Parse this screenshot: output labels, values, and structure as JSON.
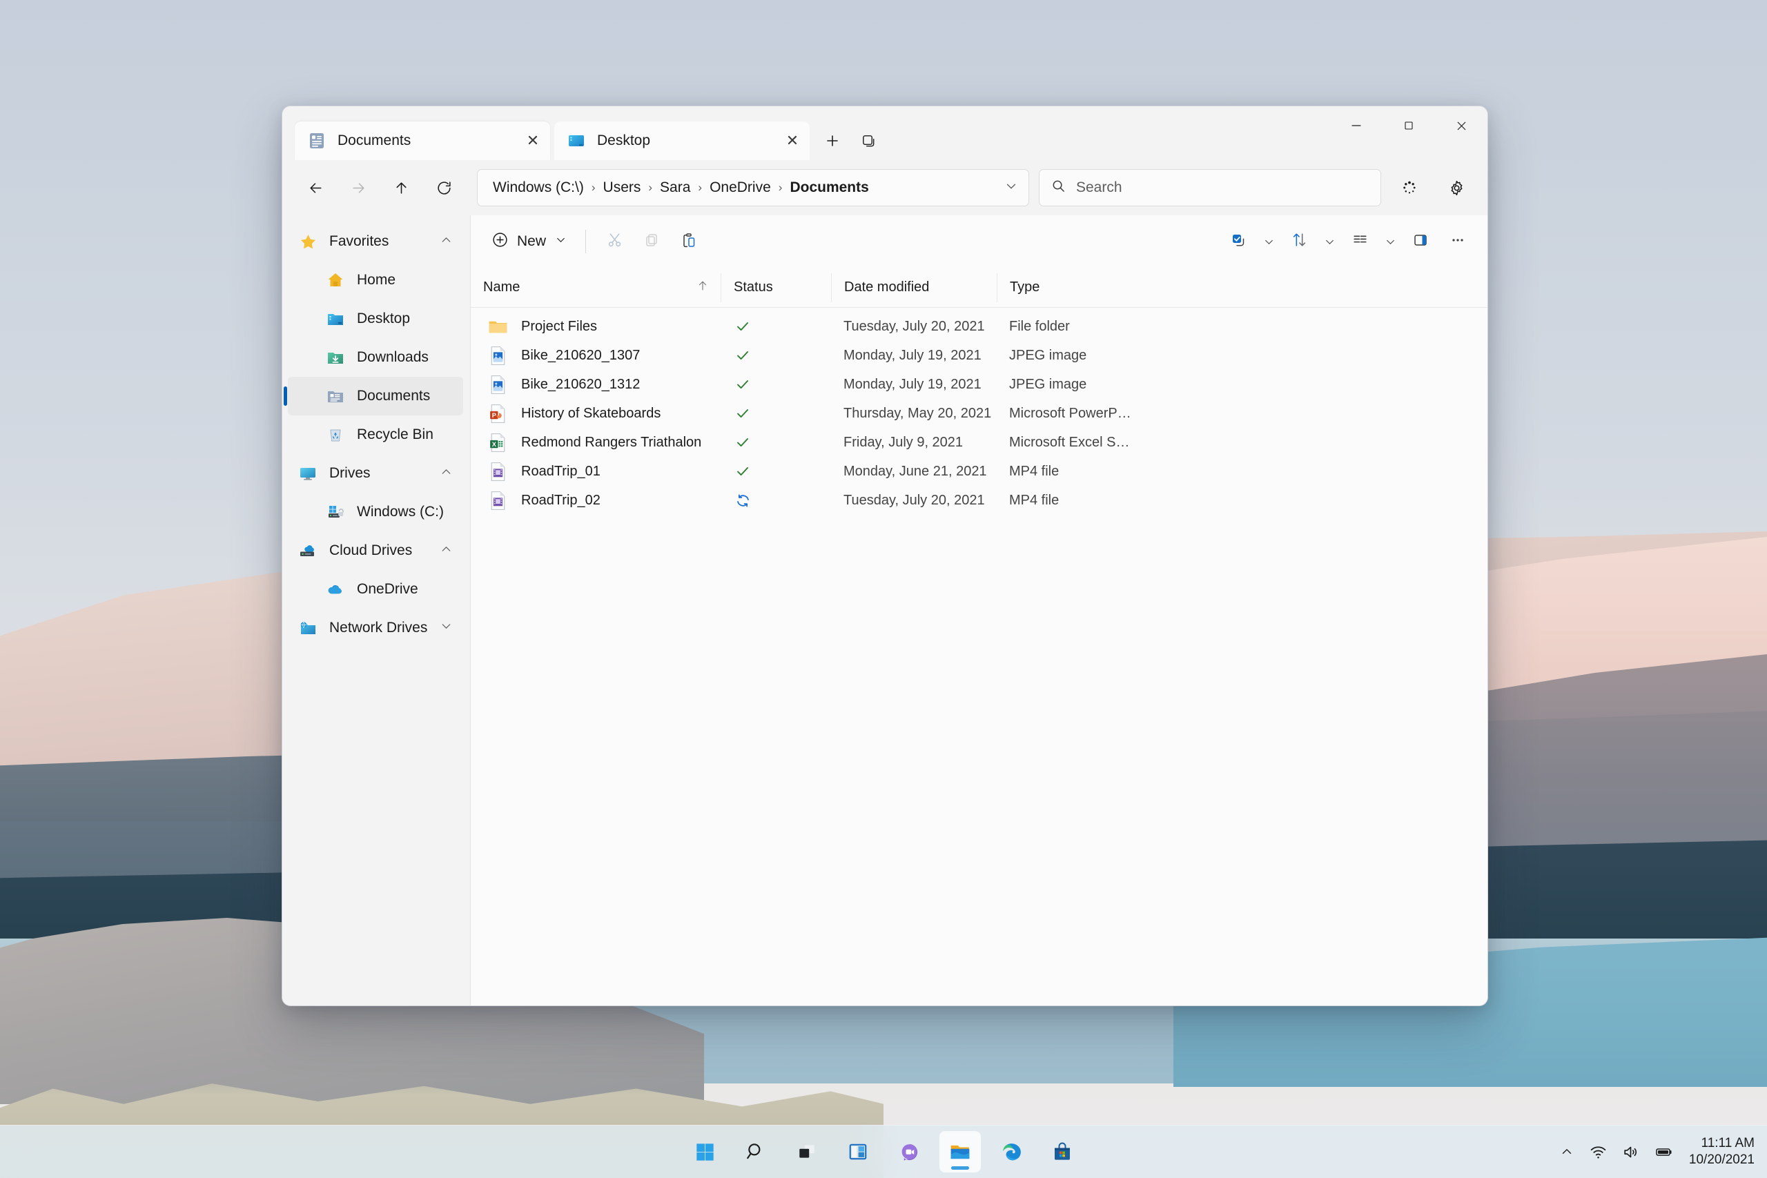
{
  "window": {
    "tabs": [
      {
        "label": "Documents",
        "icon": "documents-folder-icon",
        "active": true,
        "close": "✕"
      },
      {
        "label": "Desktop",
        "icon": "desktop-folder-icon",
        "active": false,
        "close": "✕"
      }
    ],
    "new_tab_tooltip": "Add new tab",
    "tab_list_tooltip": "Tab list",
    "controls": {
      "minimize": "−",
      "maximize": "☐",
      "close": "✕"
    }
  },
  "navbar": {
    "back": "back-arrow",
    "forward": "forward-arrow",
    "up": "up-arrow",
    "refresh": "refresh-arrow",
    "breadcrumb": [
      "Windows (C:\\)",
      "Users",
      "Sara",
      "OneDrive",
      "Documents"
    ],
    "breadcrumb_separator": "›",
    "breadcrumb_chevron": "⌄",
    "search": {
      "placeholder": "Search",
      "value": ""
    },
    "progress_icon": "progress-dots-icon",
    "settings_icon": "gear-icon"
  },
  "sidebar": {
    "groups": [
      {
        "label": "Favorites",
        "icon": "star-icon",
        "expanded": true,
        "chevron": "up",
        "items": [
          {
            "label": "Home",
            "icon": "home-icon",
            "selected": false
          },
          {
            "label": "Desktop",
            "icon": "desktop-folder-icon",
            "selected": false
          },
          {
            "label": "Downloads",
            "icon": "downloads-folder-icon",
            "selected": false
          },
          {
            "label": "Documents",
            "icon": "documents-folder-icon",
            "selected": true
          },
          {
            "label": "Recycle Bin",
            "icon": "recycle-bin-icon",
            "selected": false
          }
        ]
      },
      {
        "label": "Drives",
        "icon": "monitor-icon",
        "expanded": true,
        "chevron": "up",
        "items": [
          {
            "label": "Windows (C:)",
            "icon": "windows-drive-icon",
            "selected": false
          }
        ]
      },
      {
        "label": "Cloud Drives",
        "icon": "cloud-drive-icon",
        "expanded": true,
        "chevron": "up",
        "items": [
          {
            "label": "OneDrive",
            "icon": "onedrive-icon",
            "selected": false
          }
        ]
      },
      {
        "label": "Network Drives",
        "icon": "network-drive-icon",
        "expanded": false,
        "chevron": "down",
        "items": []
      }
    ]
  },
  "toolbar": {
    "new_label": "New",
    "new_icon": "plus-circle-icon",
    "new_chevron": "⌄",
    "cut_icon": "scissors-icon",
    "copy_icon": "copy-icon",
    "paste_icon": "paste-icon",
    "select_icon": "select-checkbox-icon",
    "select_chevron": "⌄",
    "sort_icon": "sort-arrows-icon",
    "sort_chevron": "⌄",
    "view_icon": "view-list-icon",
    "view_chevron": "⌄",
    "details_pane_icon": "details-pane-icon",
    "more_icon": "more-ellipsis-icon"
  },
  "filelist": {
    "columns": [
      {
        "label": "Name",
        "sort": "ascending"
      },
      {
        "label": "Status",
        "sort": null
      },
      {
        "label": "Date modified",
        "sort": null
      },
      {
        "label": "Type",
        "sort": null
      }
    ],
    "rows": [
      {
        "name": "Project Files",
        "icon": "folder-icon",
        "status": "synced",
        "date": "Tuesday, July 20, 2021",
        "type": "File folder"
      },
      {
        "name": "Bike_210620_1307",
        "icon": "jpeg-file-icon",
        "status": "synced",
        "date": "Monday, July 19, 2021",
        "type": "JPEG image"
      },
      {
        "name": "Bike_210620_1312",
        "icon": "jpeg-file-icon",
        "status": "synced",
        "date": "Monday, July 19, 2021",
        "type": "JPEG image"
      },
      {
        "name": "History of Skateboards",
        "icon": "powerpoint-icon",
        "status": "synced",
        "date": "Thursday, May 20, 2021",
        "type": "Microsoft PowerPoi..."
      },
      {
        "name": "Redmond Rangers Triathalon",
        "icon": "excel-icon",
        "status": "synced",
        "date": "Friday, July 9, 2021",
        "type": "Microsoft Excel Spr..."
      },
      {
        "name": "RoadTrip_01",
        "icon": "video-file-icon",
        "status": "synced",
        "date": "Monday, June 21, 2021",
        "type": "MP4 file"
      },
      {
        "name": "RoadTrip_02",
        "icon": "video-file-icon",
        "status": "syncing",
        "date": "Tuesday, July 20, 2021",
        "type": "MP4 file"
      }
    ]
  },
  "taskbar": {
    "items": [
      {
        "name": "start-button",
        "label": "Start"
      },
      {
        "name": "search-button",
        "label": "Search"
      },
      {
        "name": "task-view-button",
        "label": "Task view"
      },
      {
        "name": "widgets-button",
        "label": "Widgets"
      },
      {
        "name": "chat-button",
        "label": "Chat"
      },
      {
        "name": "file-explorer-button",
        "label": "File Explorer",
        "active": true
      },
      {
        "name": "edge-button",
        "label": "Microsoft Edge"
      },
      {
        "name": "store-button",
        "label": "Microsoft Store"
      }
    ],
    "tray": {
      "overflow_chevron": "⌃",
      "wifi_icon": "wifi-icon",
      "volume_icon": "speaker-icon",
      "battery_icon": "battery-icon",
      "time": "11:11 AM",
      "date": "10/20/2021"
    }
  },
  "colors": {
    "accent": "#005fb8",
    "sync_ok": "#2e7d32",
    "syncing": "#1a6fd4",
    "folder": "#f5bf4a"
  }
}
